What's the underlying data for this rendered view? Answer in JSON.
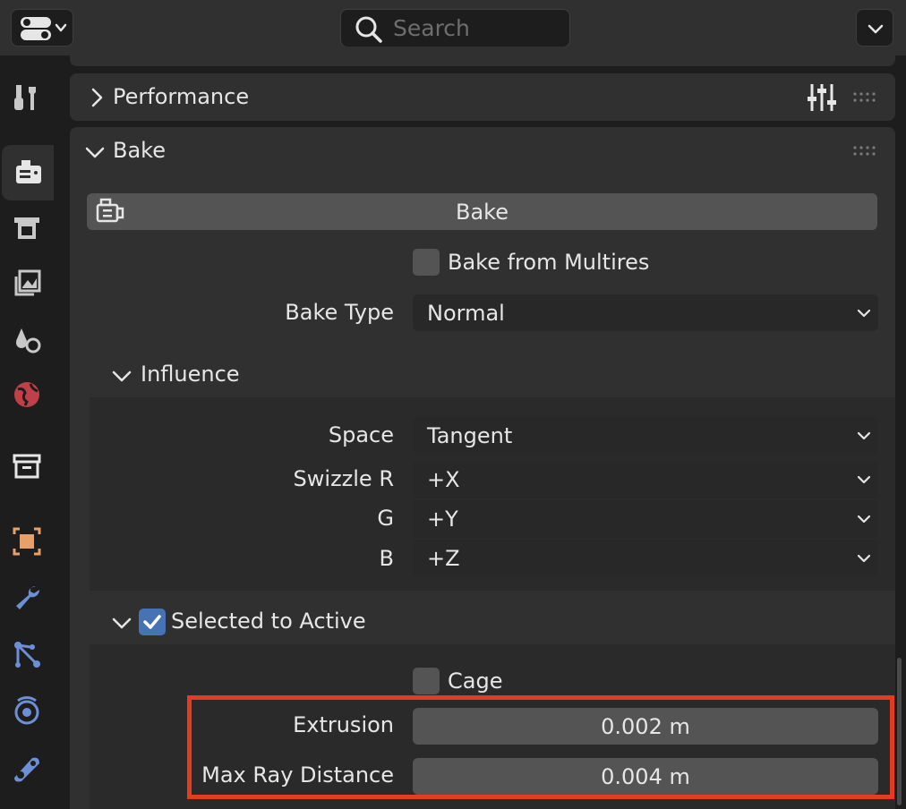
{
  "header": {
    "search_placeholder": "Search"
  },
  "sidebar": {
    "tabs": [
      {
        "icon": "tool-icon"
      },
      {
        "icon": "render-icon"
      },
      {
        "icon": "output-icon"
      },
      {
        "icon": "view-layer-icon"
      },
      {
        "icon": "scene-icon"
      },
      {
        "icon": "world-icon"
      },
      {
        "icon": "collection-icon"
      },
      {
        "icon": "object-icon"
      },
      {
        "icon": "modifier-icon"
      },
      {
        "icon": "particles-icon"
      },
      {
        "icon": "physics-icon"
      },
      {
        "icon": "constraints-icon"
      }
    ]
  },
  "panels": {
    "performance": {
      "title": "Performance"
    },
    "bake": {
      "title": "Bake",
      "bake_button": "Bake",
      "bake_from_multires": "Bake from Multires",
      "bake_type_label": "Bake Type",
      "bake_type_value": "Normal",
      "influence": {
        "title": "Influence",
        "space_label": "Space",
        "space_value": "Tangent",
        "swizzle_r_label": "Swizzle R",
        "swizzle_r_value": "+X",
        "g_label": "G",
        "g_value": "+Y",
        "b_label": "B",
        "b_value": "+Z"
      },
      "selected_to_active": {
        "title": "Selected to Active",
        "checked": true,
        "cage_label": "Cage",
        "extrusion_label": "Extrusion",
        "extrusion_value": "0.002 m",
        "max_ray_label": "Max Ray Distance",
        "max_ray_value": "0.004 m"
      }
    }
  },
  "colors": {
    "accent": "#4772b3",
    "highlight": "#e53b23"
  }
}
